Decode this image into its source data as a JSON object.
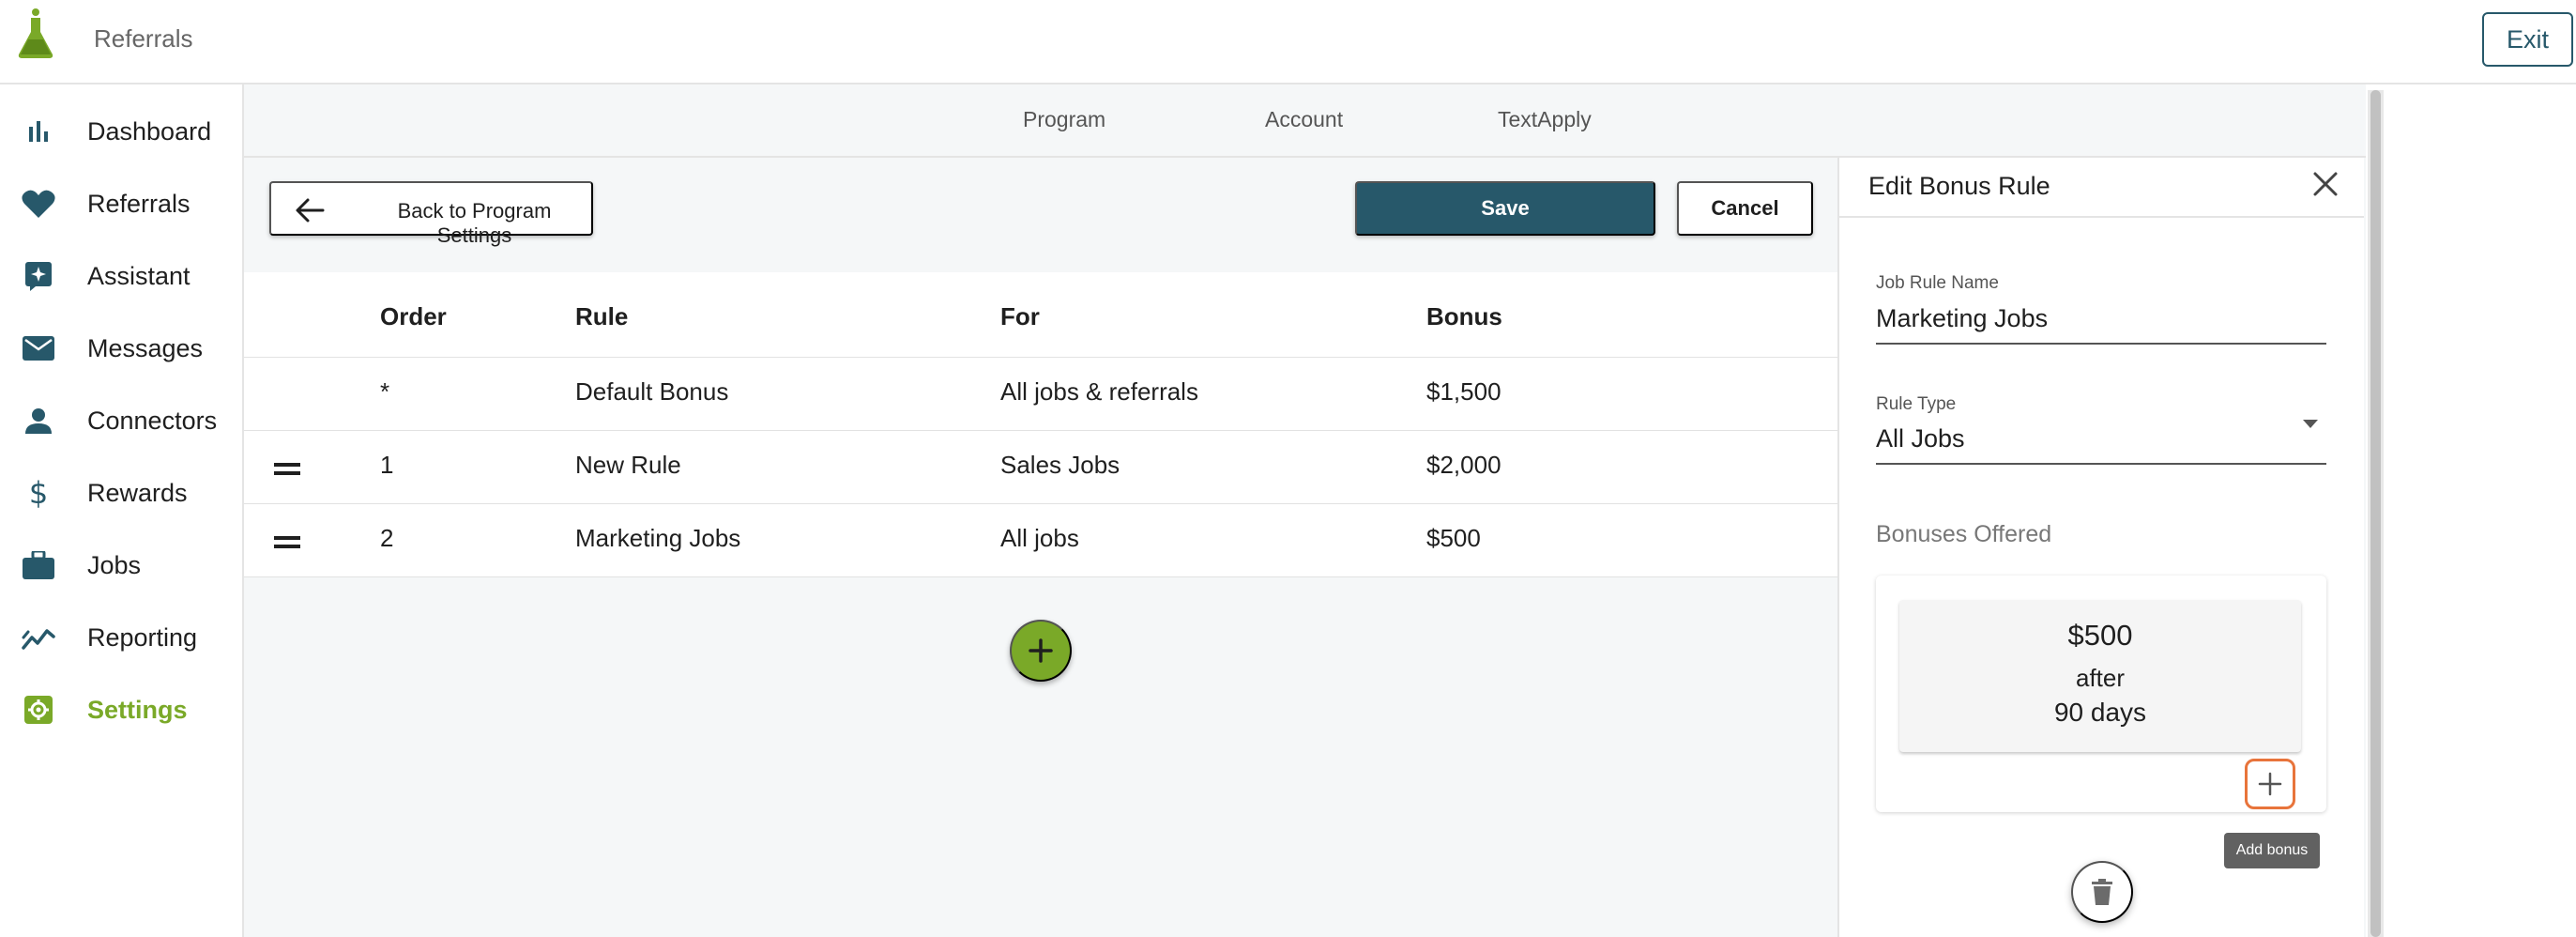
{
  "app": {
    "title": "Referrals",
    "exit_label": "Exit"
  },
  "sidebar": {
    "items": [
      {
        "label": "Dashboard",
        "icon": "bar-chart-icon",
        "active": false
      },
      {
        "label": "Referrals",
        "icon": "heart-icon",
        "active": false
      },
      {
        "label": "Assistant",
        "icon": "sparkle-icon",
        "active": false
      },
      {
        "label": "Messages",
        "icon": "mail-icon",
        "active": false
      },
      {
        "label": "Connectors",
        "icon": "person-icon",
        "active": false
      },
      {
        "label": "Rewards",
        "icon": "dollar-icon",
        "active": false
      },
      {
        "label": "Jobs",
        "icon": "briefcase-icon",
        "active": false
      },
      {
        "label": "Reporting",
        "icon": "trend-icon",
        "active": false
      },
      {
        "label": "Settings",
        "icon": "gear-icon",
        "active": true
      }
    ]
  },
  "subnav": {
    "tabs": [
      "Program",
      "Account",
      "TextApply"
    ]
  },
  "toolbar": {
    "back_label": "Back to Program Settings",
    "save_label": "Save",
    "cancel_label": "Cancel"
  },
  "table": {
    "headers": [
      "Order",
      "Rule",
      "For",
      "Bonus"
    ],
    "rows": [
      {
        "order": "*",
        "rule": "Default Bonus",
        "for": "All jobs & referrals",
        "bonus": "$1,500",
        "draggable": false
      },
      {
        "order": "1",
        "rule": "New Rule",
        "for": "Sales Jobs",
        "bonus": "$2,000",
        "draggable": true
      },
      {
        "order": "2",
        "rule": "Marketing Jobs",
        "for": "All jobs",
        "bonus": "$500",
        "draggable": true
      }
    ]
  },
  "edit_panel": {
    "title": "Edit Bonus Rule",
    "job_rule_name_label": "Job Rule Name",
    "job_rule_name_value": "Marketing Jobs",
    "rule_type_label": "Rule Type",
    "rule_type_value": "All Jobs",
    "bonuses_offered_label": "Bonuses Offered",
    "bonus": {
      "amount": "$500",
      "after": "after",
      "duration": "90 days"
    },
    "add_bonus_tooltip": "Add bonus"
  },
  "colors": {
    "brand_green": "#7aa928",
    "primary_teal": "#27586a",
    "focus_orange": "#e8743b"
  }
}
